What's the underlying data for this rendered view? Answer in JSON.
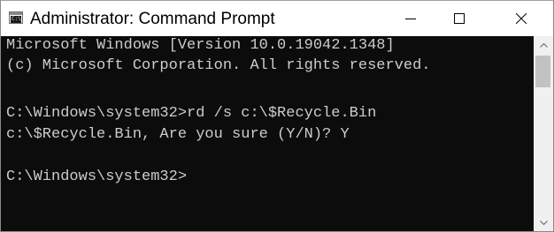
{
  "window": {
    "title": "Administrator: Command Prompt",
    "icon": "command-prompt-icon",
    "icon_text": "C:\\",
    "controls": {
      "minimize": "minimize-icon",
      "maximize": "maximize-icon",
      "close": "close-icon"
    }
  },
  "console": {
    "lines": [
      "Microsoft Windows [Version 10.0.19042.1348]",
      "(c) Microsoft Corporation. All rights reserved.",
      "",
      "C:\\Windows\\system32>rd /s c:\\$Recycle.Bin",
      "c:\\$Recycle.Bin, Are you sure (Y/N)? Y",
      "",
      "C:\\Windows\\system32>"
    ]
  },
  "colors": {
    "console_background": "#0c0c0c",
    "console_text": "#cccccc",
    "titlebar_background": "#ffffff",
    "scrollbar_track": "#f0f0f0",
    "scrollbar_thumb": "#c2c2c2"
  }
}
